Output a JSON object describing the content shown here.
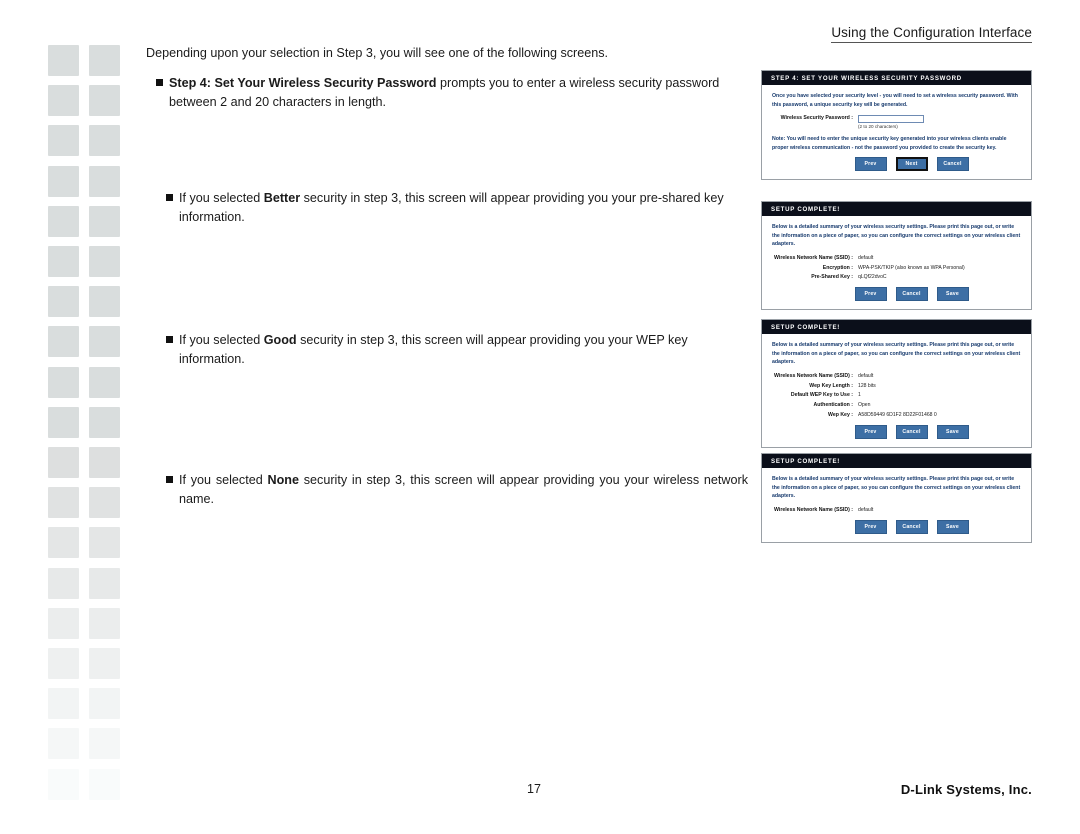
{
  "header": {
    "title": "Using the Configuration Interface"
  },
  "footer": {
    "page_number": "17",
    "brand": "D-Link Systems, Inc."
  },
  "main": {
    "intro": "Depending upon your selection in Step 3, you will see one of the following screens.",
    "bullets": [
      {
        "bold": "Step 4: Set Your Wireless Security Password",
        "rest": " prompts you to enter a wireless security password between 2 and 20 characters in length."
      },
      {
        "pre": "If you selected ",
        "bold": "Better",
        "rest": " security in step 3, this screen will appear providing you your pre-shared key information."
      },
      {
        "pre": "If you selected ",
        "bold": "Good",
        "rest": " security in step 3, this screen will appear providing you your WEP key information."
      },
      {
        "pre": "If you selected ",
        "bold": "None",
        "rest": " security in step 3, this screen will appear providing you your wireless network name."
      }
    ]
  },
  "screenshots": [
    {
      "title": "STEP 4: SET YOUR WIRELESS SECURITY PASSWORD",
      "description": "Once you have selected your security level - you will need to set a wireless security password. With this password, a unique security key will be generated.",
      "password_label": "Wireless Security Password :",
      "password_value": "",
      "password_placeholder": "",
      "password_hint": "(2 to 20 characters)",
      "note": "Note: You will need to enter the unique security key generated into your wireless clients enable proper wireless communication - not the password you provided to create the security key.",
      "buttons": [
        "Prev",
        "Next",
        "Cancel"
      ],
      "focused_button": "Next"
    },
    {
      "title": "SETUP COMPLETE!",
      "description": "Below is a detailed summary of your wireless security settings. Please print this page out, or write the information on a piece of paper, so you can configure the correct settings on your wireless client adapters.",
      "fields": [
        {
          "label": "Wireless Network Name (SSID) :",
          "value": "default"
        },
        {
          "label": "Encryption :",
          "value": "WPA-PSK/TKIP (also known as WPA Personal)"
        },
        {
          "label": "Pre-Shared Key :",
          "value": "qLQf22dvoC"
        }
      ],
      "buttons": [
        "Prev",
        "Cancel",
        "Save"
      ]
    },
    {
      "title": "SETUP COMPLETE!",
      "description": "Below is a detailed summary of your wireless security settings. Please print this page out, or write the information on a piece of paper, so you can configure the correct settings on your wireless client adapters.",
      "fields": [
        {
          "label": "Wireless Network Name (SSID) :",
          "value": "default"
        },
        {
          "label": "Wep Key Length :",
          "value": "128 bits"
        },
        {
          "label": "Default WEP Key to Use :",
          "value": "1"
        },
        {
          "label": "Authentication :",
          "value": "Open"
        },
        {
          "label": "Wep Key :",
          "value": "A58D59449 6D1F2 8D22F01468 0"
        }
      ],
      "buttons": [
        "Prev",
        "Cancel",
        "Save"
      ]
    },
    {
      "title": "SETUP COMPLETE!",
      "description": "Below is a detailed summary of your wireless security settings. Please print this page out, or write the information on a piece of paper, so you can configure the correct settings on your wireless client adapters.",
      "fields": [
        {
          "label": "Wireless Network Name (SSID) :",
          "value": "default"
        }
      ],
      "buttons": [
        "Prev",
        "Cancel",
        "Save"
      ]
    }
  ],
  "colors": {
    "shot_header_bg": "#0b0f1a",
    "shot_text_blue": "#173a6d",
    "button_blue": "#3d6fa5",
    "margin_mark": "#d9dddd"
  }
}
